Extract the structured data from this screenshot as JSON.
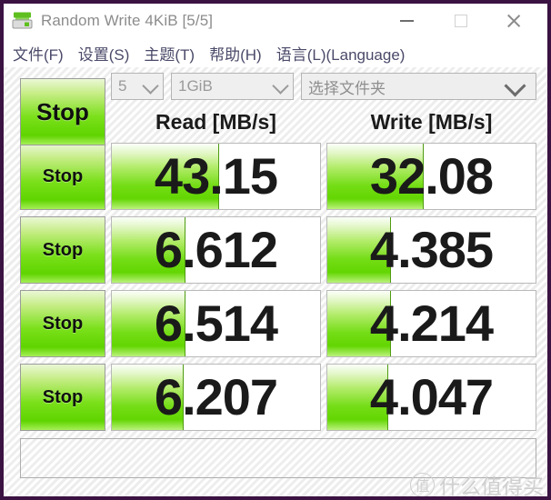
{
  "window": {
    "title": "Random Write 4KiB [5/5]",
    "app_icon": "disk-drive-icon",
    "controls": {
      "minimize": "minimize-icon",
      "maximize": "maximize-icon",
      "close": "close-icon"
    }
  },
  "menubar": {
    "items": [
      {
        "label": "文件(F)"
      },
      {
        "label": "设置(S)"
      },
      {
        "label": "主题(T)"
      },
      {
        "label": "帮助(H)"
      },
      {
        "label": "语言(L)(Language)"
      }
    ]
  },
  "toolbar": {
    "all_button_label": "Stop",
    "run_count": "5",
    "test_size": "1GiB",
    "folder_placeholder": "选择文件夹"
  },
  "headers": {
    "read": "Read [MB/s]",
    "write": "Write [MB/s]"
  },
  "rows": [
    {
      "button": "Stop",
      "read": "43.15",
      "write": "32.08",
      "read_fill": 51,
      "write_fill": 46
    },
    {
      "button": "Stop",
      "read": "6.612",
      "write": "4.385",
      "read_fill": 35,
      "write_fill": 30
    },
    {
      "button": "Stop",
      "read": "6.514",
      "write": "4.214",
      "read_fill": 35,
      "write_fill": 30
    },
    {
      "button": "Stop",
      "read": "6.207",
      "write": "4.047",
      "read_fill": 34,
      "write_fill": 29
    }
  ],
  "statusbar": {
    "text": ""
  },
  "watermark": {
    "mark": "值",
    "text": "什么值得买"
  },
  "colors": {
    "window_border": "#3b1342",
    "green_bright": "#63d602",
    "green_light": "#bbf27c",
    "title_text": "#8c8c8c",
    "menu_text": "#4a4a6a"
  }
}
